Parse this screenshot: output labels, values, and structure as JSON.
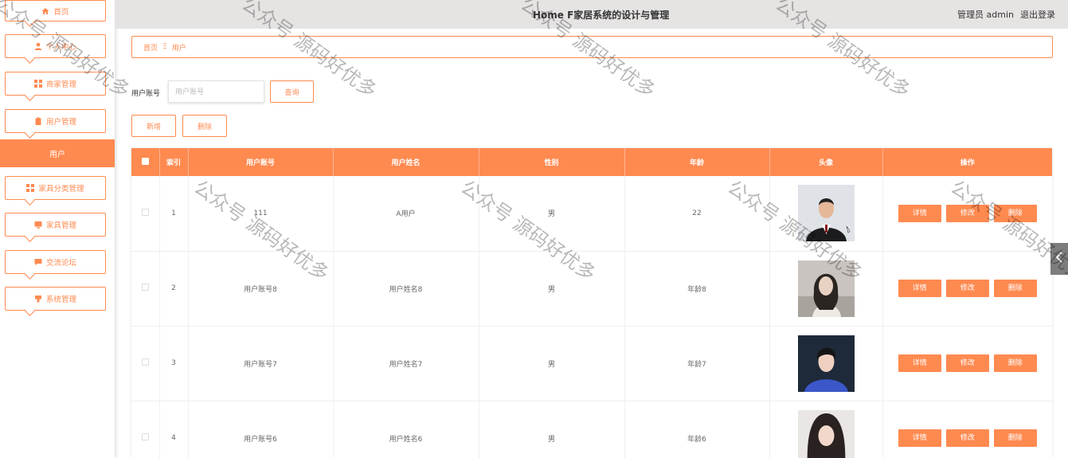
{
  "header": {
    "title": "Home F家居系统的设计与管理",
    "user_label": "管理员 admin",
    "logout": "退出登录"
  },
  "sidebar": {
    "items": [
      {
        "label": "首页",
        "icon": "home-icon"
      },
      {
        "label": "个人中心",
        "icon": "user-icon"
      },
      {
        "label": "商家管理",
        "icon": "grid-icon"
      },
      {
        "label": "用户管理",
        "icon": "clipboard-icon"
      },
      {
        "label": "用户",
        "icon": ""
      },
      {
        "label": "家具分类管理",
        "icon": "grid-icon"
      },
      {
        "label": "家具管理",
        "icon": "monitor-icon"
      },
      {
        "label": "交流论坛",
        "icon": "chat-icon"
      },
      {
        "label": "系统管理",
        "icon": "settings-icon"
      }
    ]
  },
  "breadcrumb": {
    "home": "首页",
    "separator": "Ξ",
    "current": "用户"
  },
  "search": {
    "label": "用户账号",
    "placeholder": "用户账号",
    "query_button": "查询"
  },
  "actions": {
    "add": "新增",
    "delete": "删除"
  },
  "table": {
    "columns": [
      "",
      "索引",
      "用户账号",
      "用户姓名",
      "性别",
      "年龄",
      "头像",
      "操作"
    ],
    "row_buttons": [
      "详情",
      "修改",
      "删除"
    ],
    "rows": [
      {
        "index": "1",
        "account": "111",
        "name": "A用户",
        "gender": "男",
        "age": "22"
      },
      {
        "index": "2",
        "account": "用户账号8",
        "name": "用户姓名8",
        "gender": "男",
        "age": "年龄8"
      },
      {
        "index": "3",
        "account": "用户账号7",
        "name": "用户姓名7",
        "gender": "男",
        "age": "年龄7"
      },
      {
        "index": "4",
        "account": "用户账号6",
        "name": "用户姓名6",
        "gender": "男",
        "age": "年龄6"
      }
    ]
  },
  "watermark": "公众号 源码好优多",
  "colors": {
    "accent": "#ff8a50",
    "header_bg": "#e6e3e3",
    "side_tab": "#7d7d7d"
  }
}
